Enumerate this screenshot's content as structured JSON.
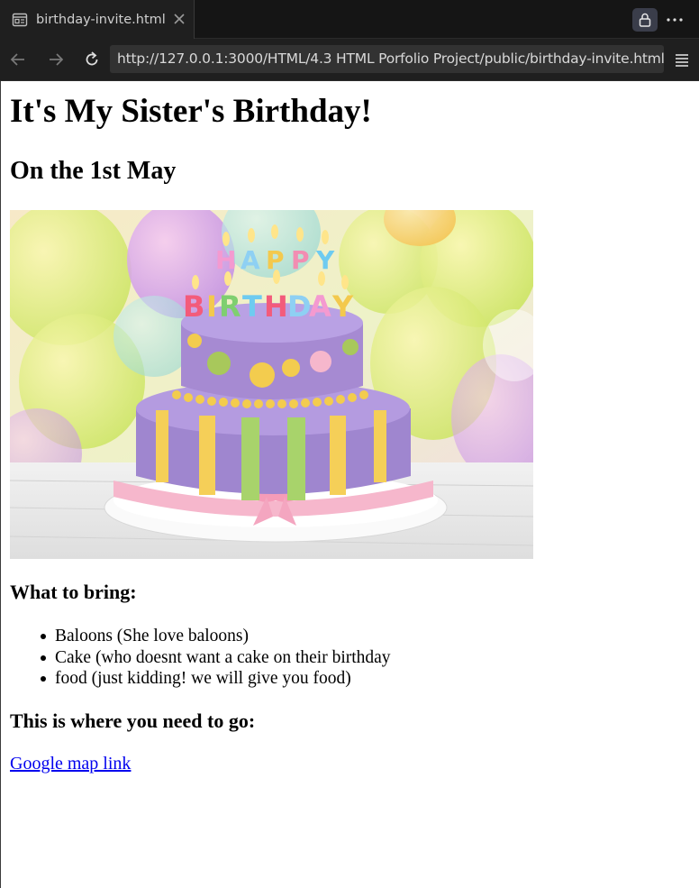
{
  "browser": {
    "tab_title": "birthday-invite.html",
    "url": "http://127.0.0.1:3000/HTML/4.3 HTML Porfolio Project/public/birthday-invite.html",
    "icons": [
      "page-icon",
      "close-icon",
      "lock-icon",
      "more-icon",
      "back-icon",
      "forward-icon",
      "reload-icon",
      "menu-icon"
    ]
  },
  "page": {
    "heading": "It's My Sister's Birthday!",
    "subheading": "On the 1st May",
    "cake_candles_text": "HAPPY BIRTHDAY",
    "bring_heading": "What to bring:",
    "bring_items": [
      "Baloons (She love baloons)",
      "Cake (who doesnt want a cake on their birthday",
      "food (just kidding! we will give you food)"
    ],
    "where_heading": "This is where you need to go:",
    "map_link_text": "Google map link"
  },
  "colors": {
    "chrome_bg": "#1f1f1f",
    "link": "#0000ee",
    "cake_purple": "#9e86c9",
    "cake_pink": "#f4b6c9"
  }
}
